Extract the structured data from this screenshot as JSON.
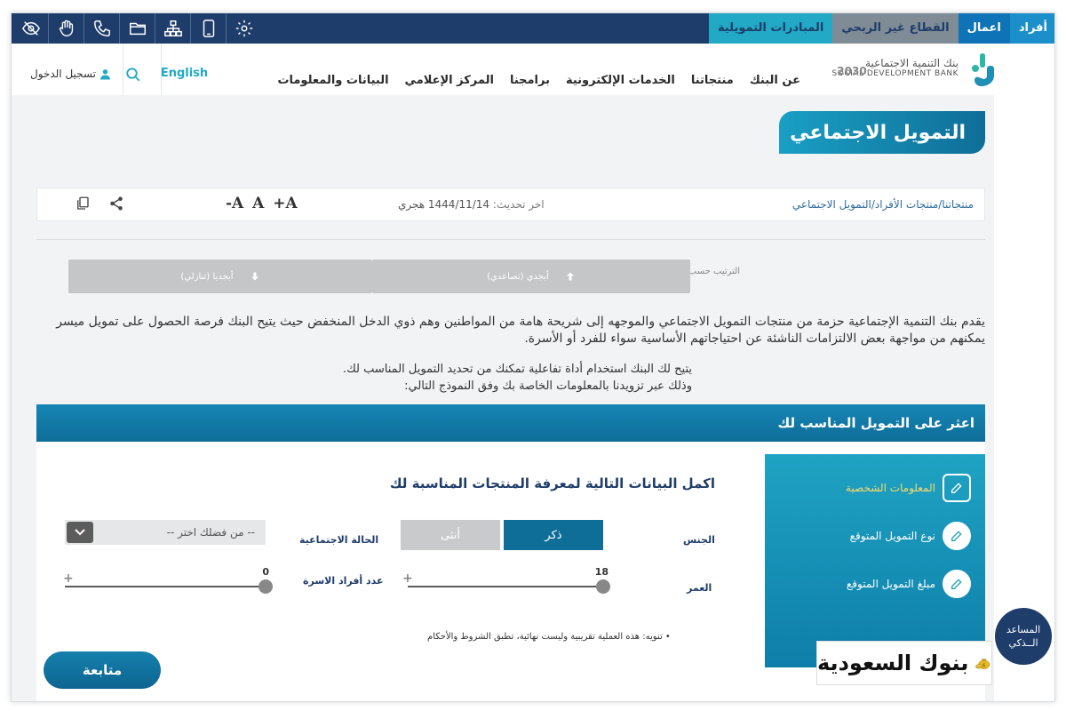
{
  "topbar": {
    "segments": [
      "أفراد",
      "اعمال",
      "القطاع غير الربحي",
      "المبادرات التمويلية"
    ],
    "accessibility_icons": [
      "eye-slash-icon",
      "sign-language-icon",
      "phone-icon",
      "folder-icon",
      "sitemap-icon",
      "mobile-icon",
      "settings-icon"
    ]
  },
  "header": {
    "logo_ar": "بنك التنمية الاجتماعية",
    "logo_en": "SOCIAL DEVELOPMENT BANK",
    "vision": "2030",
    "nav": [
      "عن البنك",
      "منتجاتنا",
      "الخدمات الإلكترونية",
      "برامجنا",
      "المركز الإعلامي",
      "البيانات والمعلومات"
    ],
    "lang": "English",
    "login": "تسجيل الدخول"
  },
  "page": {
    "title": "التمويل الاجتماعي",
    "breadcrumb": "منتجاتنا/منتجات الأفراد/التمويل الاجتماعي",
    "update_label": "اخر تحديث:",
    "update_value": "1444/11/14 هجري",
    "font_controls": [
      "-A",
      "A",
      "+A"
    ],
    "sort_label": "الترتيب حسب",
    "sort_asc": "أبجدي (تصاعدي)",
    "sort_desc": "أبجديا (تنازلي)",
    "intro": "يقدم بنك التنمية الإجتماعية حزمة من منتجات التمويل الاجتماعي والموجهه إلى شريحة هامة من المواطنين وهم ذوي الدخل المنخفض حيث يتيح البنك فرصة الحصول على تمويل ميسر يمكنهم من مواجهة بعض الالتزامات الناشئة عن احتياجاتهم الأساسية سواء للفرد أو الأسرة.",
    "intro2_line1": "يتيح لك البنك استخدام أداة تفاعلية تمكنك من تحديد التمويل المناسب لك.",
    "intro2_line2": "وذلك عبر تزويدنا بالمعلومات الخاصة بك وفق النموذج التالي:"
  },
  "finder": {
    "title": "اعثر على التمويل المناسب لك",
    "steps": [
      "المعلومات الشخصية",
      "نوع التمويل المتوقع",
      "مبلغ التمويل المتوقع"
    ],
    "form_title": "اكمل البيانات التالية لمعرفة المنتجات المناسبة لك",
    "gender_label": "الجنس",
    "male": "ذكر",
    "female": "أنثى",
    "marital_label": "الحالة الاجتماعية",
    "marital_placeholder": "-- من فضلك اختر --",
    "age_label": "العمر",
    "age_value": "18",
    "family_label": "عدد أفراد الاسرة",
    "family_value": "0",
    "note": "• تنويه: هذه العملية تقريبية وليست نهائية، تطبق الشروط والأحكام",
    "next": "متابعة"
  },
  "assistant": {
    "line1": "المساعد",
    "line2": "الــذكي"
  },
  "watermark": "بنوك السعودية",
  "colors": {
    "navy": "#1e3d6b",
    "teal": "#21a9c5",
    "blue": "#0f6e98",
    "step_active": "#f5d96b"
  }
}
